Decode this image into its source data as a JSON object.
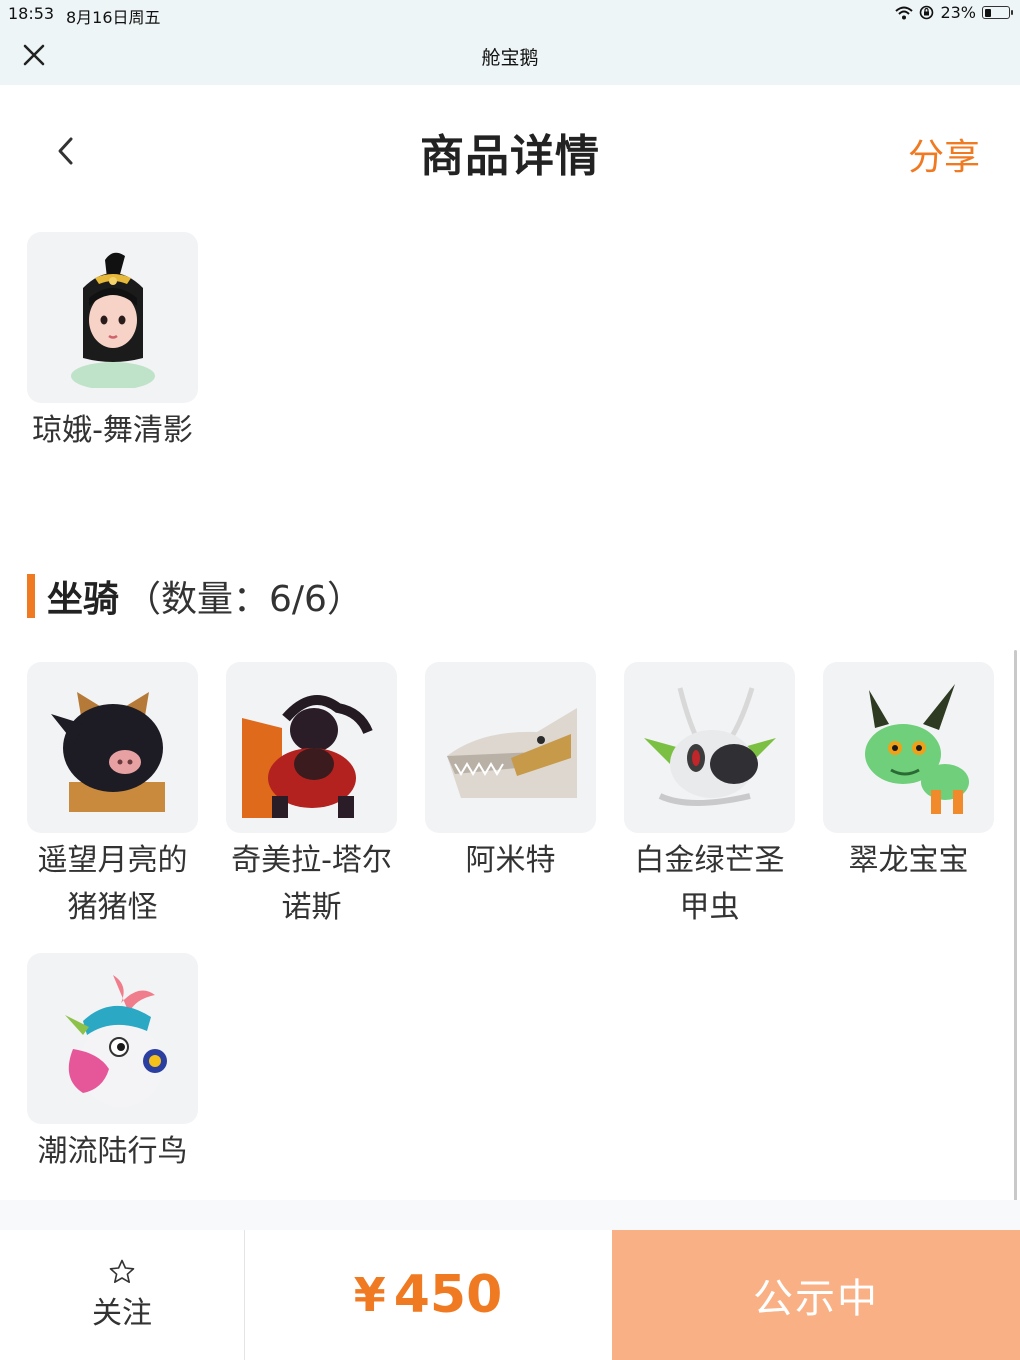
{
  "status_bar": {
    "time": "18:53",
    "date": "8月16日周五",
    "battery": "23%"
  },
  "header": {
    "app_title": "舱宝鹅",
    "page_title": "商品详情",
    "share_label": "分享"
  },
  "skins": [
    {
      "name": "琼娥-舞清影",
      "icon": "character-portrait-icon"
    }
  ],
  "mounts_section": {
    "title": "坐骑",
    "count": "（数量：6/6）"
  },
  "mounts": [
    {
      "name": "遥望月亮的猪猪怪",
      "icon": "pig-mount-icon"
    },
    {
      "name": "奇美拉-塔尔诺斯",
      "icon": "chimera-mount-icon"
    },
    {
      "name": "阿米特",
      "icon": "crocodile-mount-icon"
    },
    {
      "name": "白金绿芒圣甲虫",
      "icon": "beetle-mount-icon"
    },
    {
      "name": "翠龙宝宝",
      "icon": "dragon-mount-icon"
    },
    {
      "name": "潮流陆行鸟",
      "icon": "bird-mount-icon"
    }
  ],
  "bottom_bar": {
    "follow_label": "关注",
    "currency": "¥",
    "price": "450",
    "status_label": "公示中"
  },
  "colors": {
    "accent": "#f07a22",
    "status_button": "#f9b084"
  }
}
